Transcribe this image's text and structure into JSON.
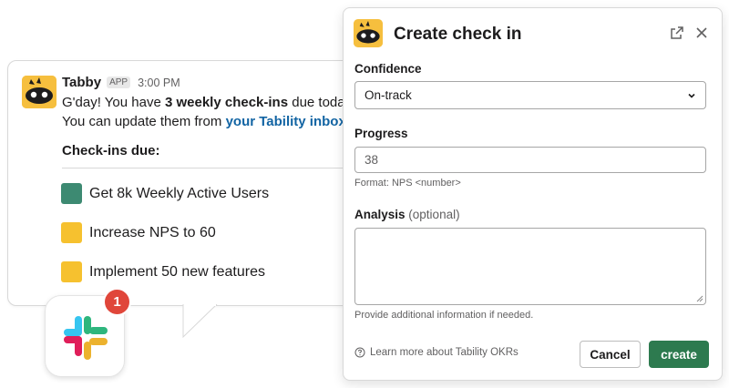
{
  "message": {
    "sender": "Tabby",
    "badge": "APP",
    "time": "3:00 PM",
    "line1_pre": "G'day! You have ",
    "line1_bold": "3 weekly check-ins",
    "line1_post": " due today.",
    "line2_pre": "You can update them from ",
    "line2_link": "your Tability inbox",
    "line2_post": ".",
    "due_title": "Check-ins due:",
    "checkins": [
      {
        "label": "Get 8k Weekly Active Users",
        "color": "#3d8a72"
      },
      {
        "label": "Increase NPS to 60",
        "color": "#f6c12f"
      },
      {
        "label": "Implement 50 new features",
        "color": "#f6c12f"
      }
    ],
    "notification_count": "1"
  },
  "modal": {
    "title": "Create check in",
    "confidence_label": "Confidence",
    "confidence_value": "On-track",
    "progress_label": "Progress",
    "progress_value": "38",
    "progress_hint": "Format: NPS <number>",
    "analysis_label": "Analysis",
    "analysis_optional": "(optional)",
    "analysis_hint": "Provide additional information if needed.",
    "learn_more": "Learn more about Tability OKRs",
    "cancel_label": "Cancel",
    "create_label": "create"
  },
  "colors": {
    "accent_green": "#2d7a4f",
    "link_blue": "#1264a3",
    "badge_red": "#e0463a",
    "tabby_yellow": "#f6bf3e"
  },
  "icons": [
    "tabby-avatar-icon",
    "slack-logo-icon",
    "external-link-icon",
    "close-icon",
    "chevron-down-icon",
    "help-circle-icon"
  ]
}
